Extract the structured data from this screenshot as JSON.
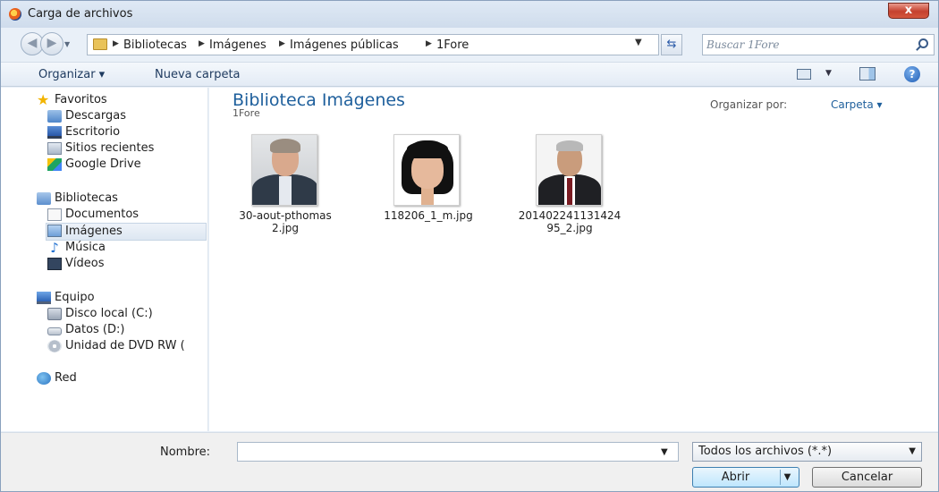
{
  "window": {
    "title": "Carga de archivos",
    "close": "x"
  },
  "nav": {
    "breadcrumbs": [
      "Bibliotecas",
      "Imágenes",
      "Imágenes públicas",
      "1Fore"
    ],
    "search_placeholder": "Buscar 1Fore"
  },
  "toolbar": {
    "organize": "Organizar ▾",
    "new_folder": "Nueva carpeta"
  },
  "sidebar": {
    "favorites": {
      "label": "Favoritos",
      "items": [
        "Descargas",
        "Escritorio",
        "Sitios recientes",
        "Google Drive"
      ]
    },
    "libraries": {
      "label": "Bibliotecas",
      "items": [
        "Documentos",
        "Imágenes",
        "Música",
        "Vídeos"
      ],
      "selected": "Imágenes"
    },
    "computer": {
      "label": "Equipo",
      "items": [
        "Disco local (C:)",
        "Datos (D:)",
        "Unidad de DVD RW ("
      ]
    },
    "network": {
      "label": "Red"
    }
  },
  "content": {
    "title": "Biblioteca Imágenes",
    "subtitle": "1Fore",
    "arrange_label": "Organizar por:",
    "arrange_value": "Carpeta ▾",
    "files": [
      {
        "name_line1": "30-aout-pthomas",
        "name_line2": "2.jpg",
        "icon": "portrait-man-gray-hair"
      },
      {
        "name_line1": "118206_1_m.jpg",
        "name_line2": "",
        "icon": "portrait-woman-black-bob"
      },
      {
        "name_line1": "201402241131424",
        "name_line2": "95_2.jpg",
        "icon": "portrait-man-suit"
      }
    ]
  },
  "footer": {
    "name_label": "Nombre:",
    "name_value": "",
    "filter": "Todos los archivos (*.*)",
    "open": "Abrir",
    "cancel": "Cancelar"
  },
  "colors": {
    "accent": "#1e5f9c",
    "close": "#c5412e",
    "open_button": "#bee6fd"
  }
}
